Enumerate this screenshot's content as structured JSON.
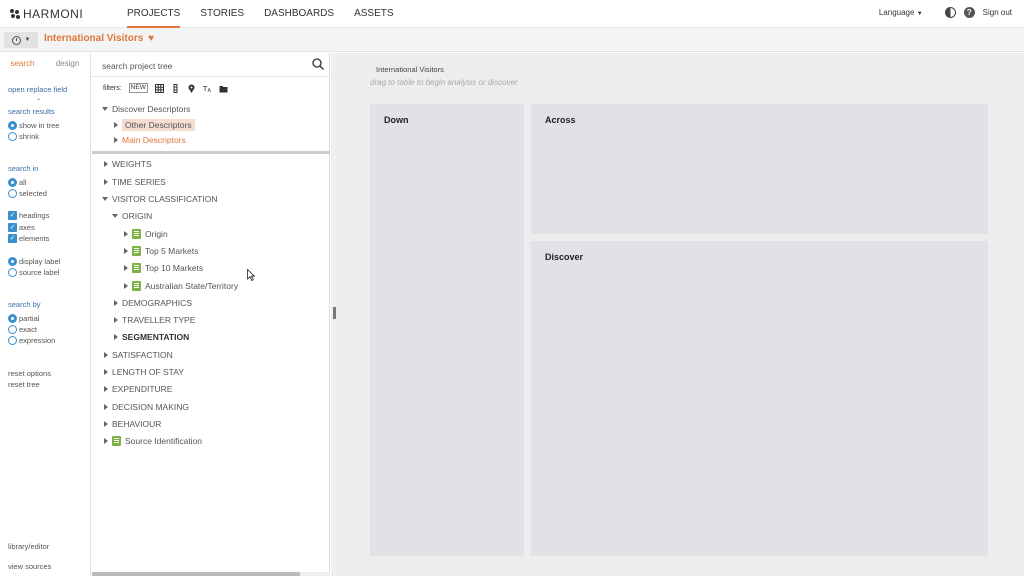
{
  "app": {
    "logo": "HARMONI",
    "nav": [
      "PROJECTS",
      "STORIES",
      "DASHBOARDS",
      "ASSETS"
    ],
    "language": "Language",
    "sign_out": "Sign out"
  },
  "titlebar": {
    "title": "International Visitors"
  },
  "options": {
    "tabs": [
      "search",
      "design"
    ],
    "open_replace_field": "open replace field",
    "search_results_head": "search results",
    "show_in_tree": "show in tree",
    "shrink": "shrink",
    "search_in_head": "search in",
    "all": "all",
    "selected": "selected",
    "headings": "headings",
    "axes": "axes",
    "elements": "elements",
    "display_label": "display label",
    "source_label": "source label",
    "search_by_head": "search by",
    "partial": "partial",
    "exact": "exact",
    "expression": "expression",
    "reset_options": "reset options",
    "reset_tree": "reset tree",
    "library_editor": "library/editor",
    "view_sources": "view sources"
  },
  "tree": {
    "search_placeholder": "search project tree",
    "filters_label": "filters:",
    "new_badge": "NEW",
    "descriptors": {
      "root": "Discover Descriptors",
      "other": "Other Descriptors",
      "main": "Main Descriptors"
    },
    "items": {
      "weights": "WEIGHTS",
      "time_series": "TIME SERIES",
      "visitor_classification": "VISITOR CLASSIFICATION",
      "origin_folder": "ORIGIN",
      "origin": "Origin",
      "top5": "Top 5 Markets",
      "top10": "Top 10 Markets",
      "aus_state": "Australian State/Territory",
      "demographics": "DEMOGRAPHICS",
      "traveller_type": "TRAVELLER TYPE",
      "segmentation": "SEGMENTATION",
      "satisfaction": "SATISFACTION",
      "length_of_stay": "LENGTH OF STAY",
      "expenditure": "EXPENDITURE",
      "decision_making": "DECISION MAKING",
      "behaviour": "BEHAVIOUR",
      "source_identification": "Source Identification"
    }
  },
  "canvas": {
    "report_name": "International Visitors",
    "drag_hint": "drag to table to begin analysis or discover",
    "zones": {
      "down": "Down",
      "across": "Across",
      "discover": "Discover"
    }
  },
  "colors": {
    "accent": "#e0773a",
    "link": "#3a6ea5",
    "control": "#3a8fcf",
    "table_icon": "#7cb342"
  }
}
